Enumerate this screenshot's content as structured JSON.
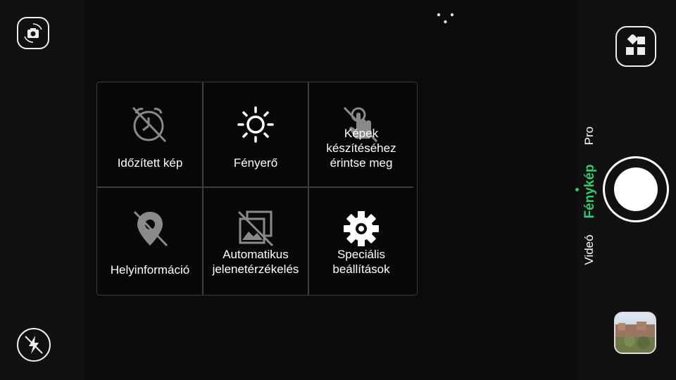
{
  "left_bar": {
    "switch_camera_icon": "switch-camera-icon",
    "flash_icon": "flash-off-icon"
  },
  "menu": {
    "items": [
      {
        "label": "Időzített kép",
        "icon": "timer-off-icon"
      },
      {
        "label": "Fényerő",
        "icon": "brightness-icon"
      },
      {
        "label": "Képek\nkészítéséhez\nérintse meg",
        "icon": "touch-capture-off-icon"
      },
      {
        "label": "Helyinformáció",
        "icon": "location-off-icon"
      },
      {
        "label": "Automatikus\njelenetérzékelés",
        "icon": "scene-detect-off-icon"
      },
      {
        "label": "Speciális\nbeállítások",
        "icon": "gear-icon"
      }
    ]
  },
  "right_bar": {
    "modes": [
      {
        "label": "Pro",
        "active": false
      },
      {
        "label": "Fénykép",
        "active": true
      },
      {
        "label": "Videó",
        "active": false
      }
    ],
    "accent_color": "#2ecc71"
  }
}
